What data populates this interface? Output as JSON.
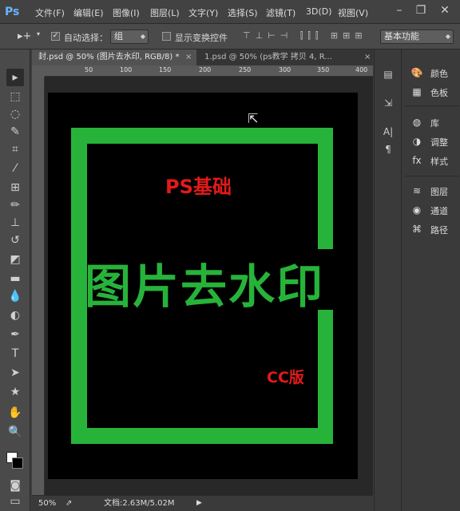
{
  "app": {
    "logo": "Ps"
  },
  "menu": [
    "文件(F)",
    "编辑(E)",
    "图像(I)",
    "图层(L)",
    "文字(Y)",
    "选择(S)",
    "滤镜(T)",
    "3D(D)",
    "视图(V)"
  ],
  "window_controls": {
    "minimize": "–",
    "restore": "❐",
    "close": "✕"
  },
  "options": {
    "tool_icon": "▸+",
    "auto_select_checked": "✓",
    "auto_select_label": "自动选择：",
    "auto_select_value": "组",
    "show_transform_label": "显示变换控件",
    "workspace_value": "基本功能"
  },
  "tabs": [
    {
      "label": "封.psd @ 50% (图片去水印, RGB/8) *",
      "close": "×"
    },
    {
      "label": "1.psd @ 50% (ps教学 拷贝 4, R...",
      "close": "×"
    }
  ],
  "ruler": {
    "top": [
      "50",
      "100",
      "150",
      "200",
      "250",
      "300",
      "350",
      "400"
    ]
  },
  "tools": [
    {
      "icon": "move-icon",
      "glyph": "▸"
    },
    {
      "icon": "marquee-icon",
      "glyph": "⬚"
    },
    {
      "icon": "lasso-icon",
      "glyph": "◌"
    },
    {
      "icon": "quick-select-icon",
      "glyph": "✎"
    },
    {
      "icon": "crop-icon",
      "glyph": "⌗"
    },
    {
      "icon": "eyedropper-icon",
      "glyph": "⁄"
    },
    {
      "icon": "healing-icon",
      "glyph": "⊞"
    },
    {
      "icon": "brush-icon",
      "glyph": "✏"
    },
    {
      "icon": "stamp-icon",
      "glyph": "⊥"
    },
    {
      "icon": "history-brush-icon",
      "glyph": "↺"
    },
    {
      "icon": "eraser-icon",
      "glyph": "◩"
    },
    {
      "icon": "gradient-icon",
      "glyph": "▬"
    },
    {
      "icon": "blur-icon",
      "glyph": "💧"
    },
    {
      "icon": "dodge-icon",
      "glyph": "◐"
    },
    {
      "icon": "pen-icon",
      "glyph": "✒"
    },
    {
      "icon": "type-icon",
      "glyph": "T"
    },
    {
      "icon": "path-select-icon",
      "glyph": "➤"
    },
    {
      "icon": "shape-icon",
      "glyph": "★"
    },
    {
      "icon": "hand-icon",
      "glyph": "✋"
    },
    {
      "icon": "zoom-icon",
      "glyph": "🔍"
    }
  ],
  "canvas": {
    "subtitle": "PS基础",
    "title": "图片去水印",
    "version": "CC版",
    "frame_color": "#27b33a",
    "accent_color": "#e31a1a"
  },
  "status": {
    "zoom": "50%",
    "doc_info": "文档:2.63M/5.02M"
  },
  "strip_icons": [
    {
      "icon": "history-icon",
      "glyph": "▤"
    },
    {
      "icon": "actions-icon",
      "glyph": "⇲"
    },
    {
      "icon": "character-icon",
      "glyph": "A|"
    },
    {
      "icon": "paragraph-icon",
      "glyph": "¶"
    }
  ],
  "panels": [
    {
      "icon": "color-icon",
      "glyph": "🎨",
      "label": "颜色"
    },
    {
      "icon": "swatches-icon",
      "glyph": "▦",
      "label": "色板"
    },
    {
      "icon": "libraries-icon",
      "glyph": "◍",
      "label": "库"
    },
    {
      "icon": "adjustments-icon",
      "glyph": "◑",
      "label": "调整"
    },
    {
      "icon": "styles-icon",
      "glyph": "fx",
      "label": "样式"
    },
    {
      "icon": "layers-icon",
      "glyph": "≋",
      "label": "图层"
    },
    {
      "icon": "channels-icon",
      "glyph": "◉",
      "label": "通道"
    },
    {
      "icon": "paths-icon",
      "glyph": "⌘",
      "label": "路径"
    }
  ]
}
